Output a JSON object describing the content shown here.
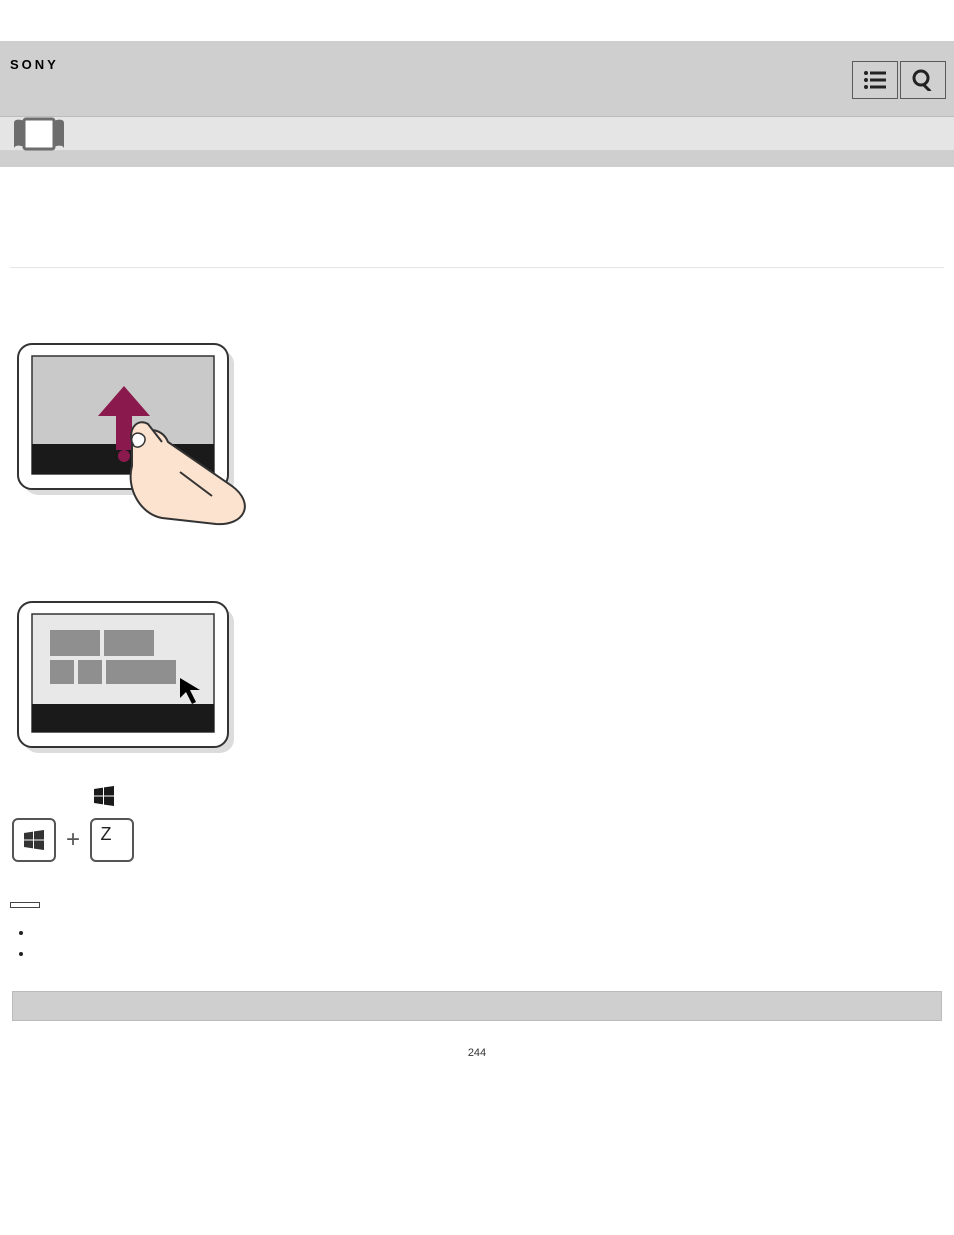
{
  "header": {
    "logo_text": "SONY",
    "menu_icon": "menu-icon",
    "search_icon": "search-icon",
    "book_icon": "book-icon"
  },
  "content": {
    "windows_key_label": "Windows",
    "combo_key_letter": "Z",
    "combo_plus": "+",
    "note_label": " ",
    "notes": [
      " ",
      " "
    ]
  },
  "footer": {
    "page_number": "244"
  }
}
